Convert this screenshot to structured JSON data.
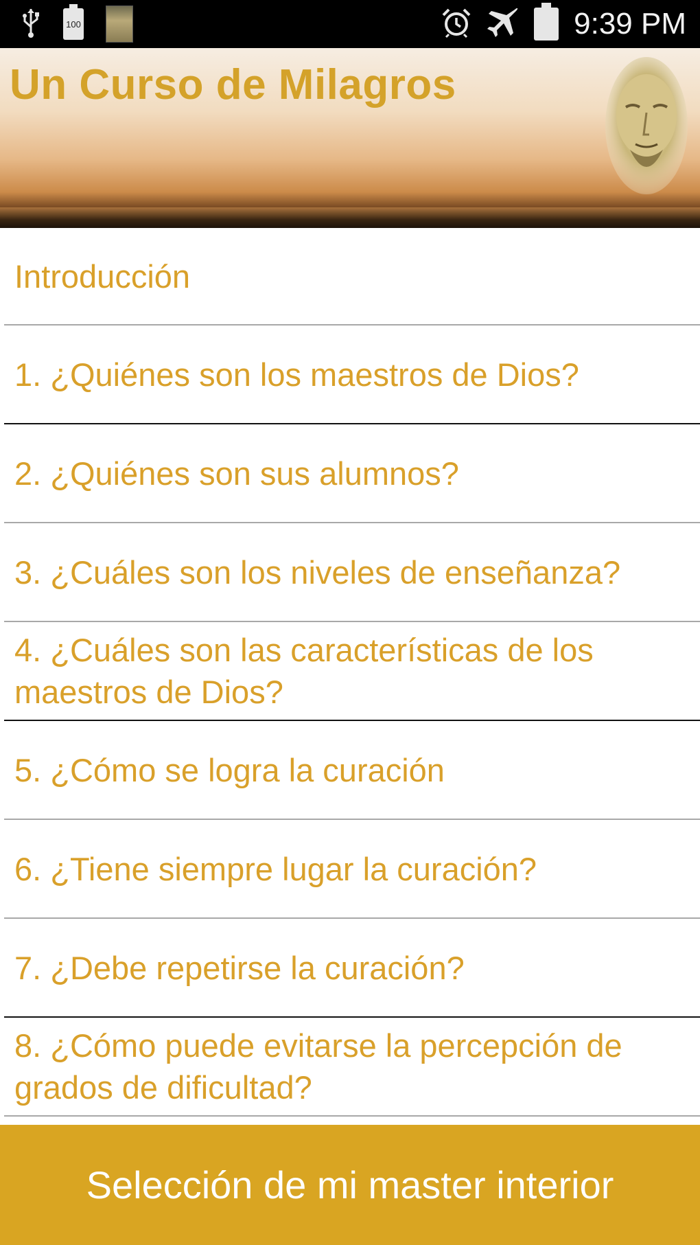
{
  "status_bar": {
    "time": "9:39 PM",
    "battery_small_label": "100",
    "icons": [
      "usb-icon",
      "battery-icon",
      "app-notification-icon",
      "alarm-icon",
      "airplane-mode-icon",
      "battery-full-icon"
    ]
  },
  "header": {
    "title": "Un Curso de Milagros"
  },
  "list": {
    "items": [
      "Introducción",
      "1. ¿Quiénes son los maestros de Dios?",
      "2. ¿Quiénes son sus alumnos?",
      "3. ¿Cuáles son los niveles de enseñanza?",
      "4. ¿Cuáles son las características de los maestros de Dios?",
      "5. ¿Cómo se logra la curación",
      "6. ¿Tiene siempre lugar la curación?",
      "7. ¿Debe repetirse la curación?",
      "8. ¿Cómo puede evitarse la percepción de grados de dificultad?"
    ]
  },
  "bottom": {
    "button_label": "Selección de mi master interior"
  },
  "colors": {
    "accent": "#d9a522",
    "item_text": "#d9a02a",
    "title_text": "#d4a22a"
  }
}
